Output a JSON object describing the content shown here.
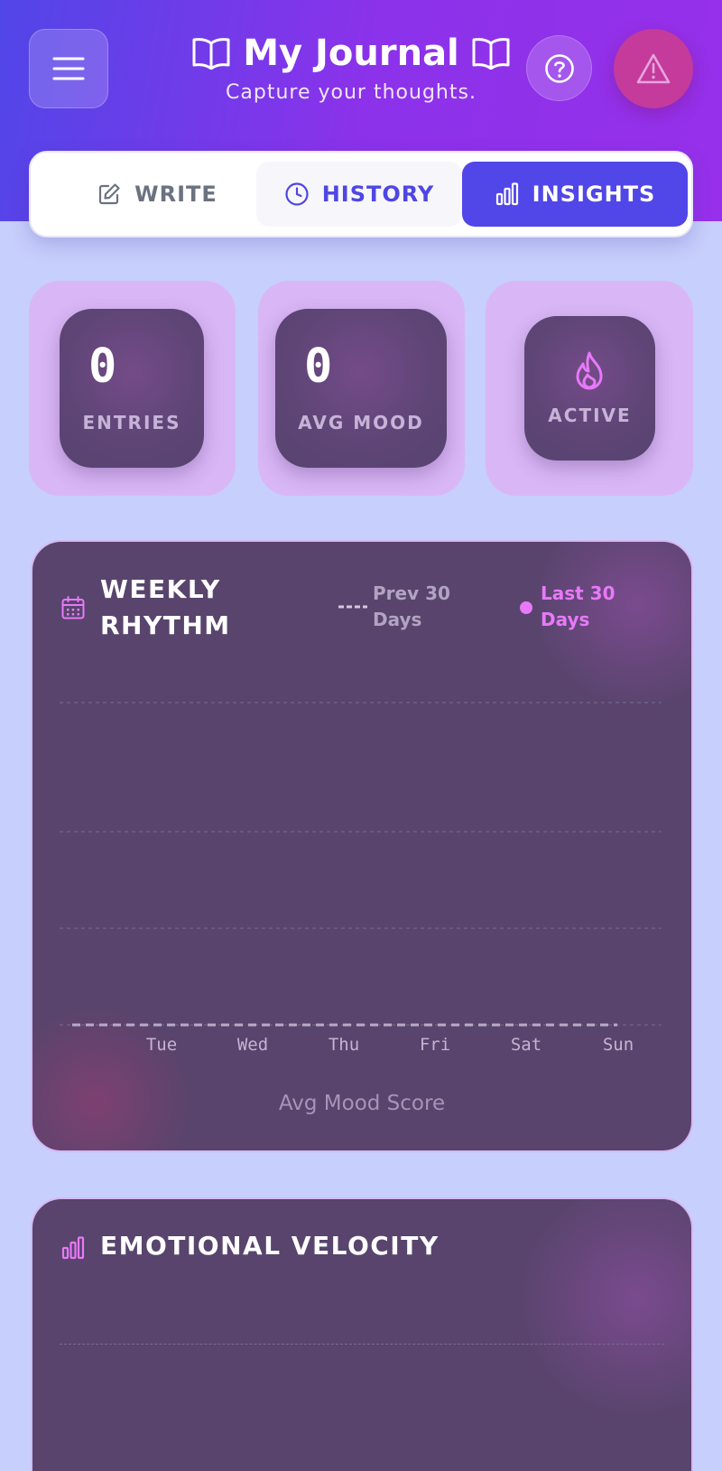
{
  "header": {
    "title": "My Journal",
    "subtitle": "Capture your thoughts."
  },
  "tabs": [
    {
      "label": "WRITE",
      "icon": "pencil-icon",
      "active": false
    },
    {
      "label": "HISTORY",
      "icon": "clock-icon",
      "active": false
    },
    {
      "label": "INSIGHTS",
      "icon": "bar-chart-icon",
      "active": true
    }
  ],
  "stats": {
    "entries_value": "0",
    "entries_label": "ENTRIES",
    "mood_value": "0",
    "mood_label": "AVG MOOD",
    "active_label": "ACTIVE"
  },
  "weekly": {
    "title_line1": "WEEKLY",
    "title_line2": "RHYTHM",
    "legend_prev_line1": "Prev 30",
    "legend_prev_line2": "Days",
    "legend_last_line1": "Last 30",
    "legend_last_line2": "Days",
    "y_label": "Avg Mood Score"
  },
  "velocity": {
    "title": "EMOTIONAL VELOCITY"
  },
  "colors": {
    "accent": "#5146e8",
    "pink": "#e879f9",
    "card": "#58446c"
  },
  "chart_data": {
    "type": "line",
    "categories": [
      "Tue",
      "Wed",
      "Thu",
      "Fri",
      "Sat",
      "Sun"
    ],
    "series": [
      {
        "name": "Prev 30 Days",
        "values": [
          0,
          0,
          0,
          0,
          0,
          0
        ]
      },
      {
        "name": "Last 30 Days",
        "values": []
      }
    ],
    "ylabel": "Avg Mood Score",
    "grid": true,
    "legend": "top-right"
  }
}
